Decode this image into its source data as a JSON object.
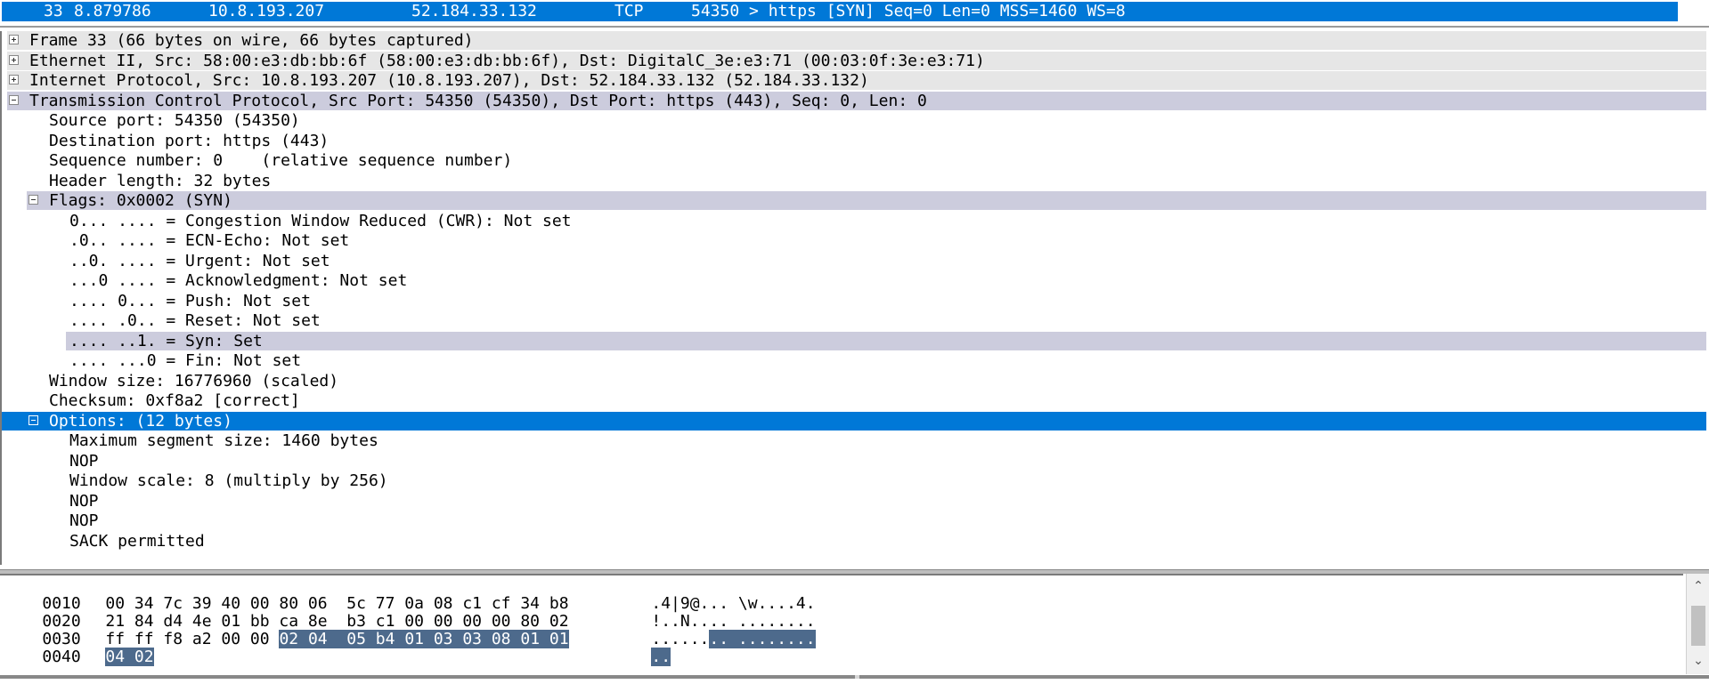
{
  "packet_list": {
    "selected_row": {
      "no": "33",
      "time": "8.879786",
      "source": "10.8.193.207",
      "destination": "52.184.33.132",
      "protocol": "TCP",
      "info": "54350 > https [SYN] Seq=0 Len=0 MSS=1460 WS=8"
    }
  },
  "details": {
    "frame": "Frame 33 (66 bytes on wire, 66 bytes captured)",
    "ethernet": "Ethernet II, Src: 58:00:e3:db:bb:6f (58:00:e3:db:bb:6f), Dst: DigitalC_3e:e3:71 (00:03:0f:3e:e3:71)",
    "ip": "Internet Protocol, Src: 10.8.193.207 (10.8.193.207), Dst: 52.184.33.132 (52.184.33.132)",
    "tcp": "Transmission Control Protocol, Src Port: 54350 (54350), Dst Port: https (443), Seq: 0, Len: 0",
    "tcp_fields": [
      "Source port: 54350 (54350)",
      "Destination port: https (443)",
      "Sequence number: 0    (relative sequence number)",
      "Header length: 32 bytes"
    ],
    "flags": "Flags: 0x0002 (SYN)",
    "flag_fields": [
      "0... .... = Congestion Window Reduced (CWR): Not set",
      ".0.. .... = ECN-Echo: Not set",
      "..0. .... = Urgent: Not set",
      "...0 .... = Acknowledgment: Not set",
      ".... 0... = Push: Not set",
      ".... .0.. = Reset: Not set",
      ".... ..1. = Syn: Set",
      ".... ...0 = Fin: Not set"
    ],
    "window_size": "Window size: 16776960 (scaled)",
    "checksum": "Checksum: 0xf8a2 [correct]",
    "options": "Options: (12 bytes)",
    "option_fields": [
      "Maximum segment size: 1460 bytes",
      "NOP",
      "Window scale: 8 (multiply by 256)",
      "NOP",
      "NOP",
      "SACK permitted"
    ]
  },
  "bytes": {
    "rows": [
      {
        "offset": "0010",
        "hex": "00 34 7c 39 40 00 80 06  5c 77 0a 08 c1 cf 34 b8",
        "ascii": ".4|9@... \\w....4."
      },
      {
        "offset": "0020",
        "hex": "21 84 d4 4e 01 bb ca 8e  b3 c1 00 00 00 00 80 02",
        "ascii": "!..N.... ........"
      },
      {
        "offset": "0030",
        "hex_plain": "ff ff f8 a2 00 00 ",
        "hex_hl": "02 04  05 b4 01 03 03 08 01 01",
        "ascii_plain": "......",
        "ascii_hl": ".. ........"
      },
      {
        "offset": "0040",
        "hex_hl": "04 02",
        "ascii_hl": ".."
      }
    ]
  },
  "icons": {
    "expand": "plus-box-icon",
    "collapse": "minus-box-icon",
    "scroll_up": "chevron-up-icon",
    "scroll_down": "chevron-down-icon"
  },
  "colors": {
    "selection": "#0078d7",
    "field_highlight": "#ccccdd",
    "byte_highlight": "#4d6a8c",
    "protocol_row": "#e6e6e6"
  }
}
